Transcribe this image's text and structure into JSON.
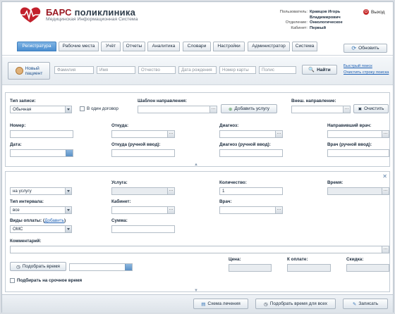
{
  "app": {
    "brand_main": "БАРС",
    "brand_rest": "поликлиника",
    "subtitle": "Медицинская Информационная Система"
  },
  "user_info": {
    "user_key": "Пользователь:",
    "user_val": "Кравцов Игорь Владимирович",
    "dept_key": "Отделение:",
    "dept_val": "Онкологическое",
    "room_key": "Кабинет:",
    "room_val": "Первый"
  },
  "exit_label": "Выход",
  "tabs": [
    {
      "label": "Регистратура"
    },
    {
      "label": "Рабочие места"
    },
    {
      "label": "Учёт"
    },
    {
      "label": "Отчеты"
    },
    {
      "label": "Аналитика"
    },
    {
      "label": "Словари"
    },
    {
      "label": "Настройки"
    },
    {
      "label": "Администратор"
    },
    {
      "label": "Система"
    }
  ],
  "refresh_label": "Обновить",
  "search": {
    "new_patient_line1": "Новый",
    "new_patient_line2": "пациент",
    "last_name": "Фамилия",
    "first_name": "Имя",
    "patronymic": "Отчество",
    "birth_date": "Дата рождения",
    "card_number": "Номер карты",
    "policy": "Полис",
    "find_label": "Найти",
    "quick_search": "Быстрый поиск",
    "clear_search": "Очистить строку поиска"
  },
  "referral": {
    "type_label": "Тип записи:",
    "type_value": "Обычная",
    "one_contract": "В один договор",
    "template_label": "Шаблон направления:",
    "add_service": "Добавить услугу",
    "external_label": "Внеш. направление:",
    "clear_label": "Очистить",
    "number_label": "Номер:",
    "from_label": "Откуда:",
    "diagnosis_label": "Диагноз:",
    "referring_doctor_label": "Направивший врач:",
    "date_label": "Дата:",
    "from_manual_label": "Откуда (ручной ввод):",
    "diagnosis_manual_label": "Диагноз (ручной ввод):",
    "doctor_manual_label": "Врач (ручной ввод):"
  },
  "booking": {
    "mode_value": "на услугу",
    "service_label": "Услуга:",
    "quantity_label": "Количество:",
    "quantity_value": "1",
    "time_label": "Время:",
    "interval_type_label": "Тип интервала:",
    "interval_value": "все",
    "cabinet_label": "Кабинет:",
    "doctor_label": "Врач:",
    "payment_label": "Виды оплаты:",
    "payment_add": "Добавить",
    "payment_value": "ОМС",
    "sum_label": "Сумма:",
    "comment_label": "Комментарий:",
    "pick_time": "Подобрать время",
    "price_label": "Цена:",
    "to_pay_label": "К оплате:",
    "discount_label": "Скидка:",
    "urgent_label": "Подбирать на срочное время"
  },
  "footer": {
    "scheme": "Схема лечения",
    "pick_all": "Подобрать время для всех",
    "record": "Записать"
  }
}
